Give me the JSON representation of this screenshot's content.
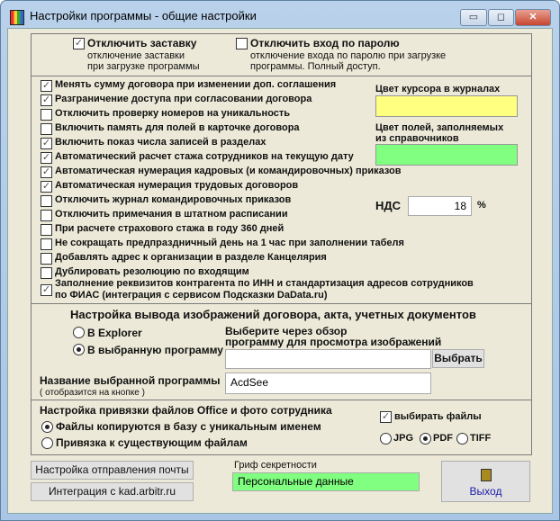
{
  "window": {
    "title": "Настройки программы - общие настройки",
    "minimize": "▭",
    "maximize": "◻",
    "close": "✕"
  },
  "top": {
    "splash": {
      "label": "Отключить заставку",
      "desc1": "отключение заставки",
      "desc2": "при загрузке программы",
      "checked": true
    },
    "password": {
      "label": "Отключить вход по паролю",
      "desc1": "отключение входа по паролю при загрузке",
      "desc2": "программы. Полный доступ.",
      "checked": false
    }
  },
  "options": [
    {
      "label": "Менять сумму договора при изменении доп. соглашения",
      "checked": true
    },
    {
      "label": "Разграничение доступа при согласовании договора",
      "checked": true
    },
    {
      "label": "Отключить проверку номеров на уникальность",
      "checked": false
    },
    {
      "label": "Включить память для полей в карточке договора",
      "checked": false
    },
    {
      "label": "Включить показ числа записей в разделах",
      "checked": true
    },
    {
      "label": "Автоматический расчет стажа сотрудников на текущую дату",
      "checked": true
    },
    {
      "label": "Автоматическая нумерация кадровых (и командировочных) приказов",
      "checked": true
    },
    {
      "label": "Автоматическая нумерация трудовых договоров",
      "checked": true
    },
    {
      "label": "Отключить журнал командировочных приказов",
      "checked": false
    },
    {
      "label": "Отключить примечания в штатном расписании",
      "checked": false
    },
    {
      "label": "При расчете страхового стажа в году 360 дней",
      "checked": false
    },
    {
      "label": "Не сокращать предпраздничный день на 1 час при заполнении табеля",
      "checked": false
    },
    {
      "label": "Добавлять адрес к организации в разделе Канцелярия",
      "checked": false
    },
    {
      "label": "Дублировать резолюцию по входящим",
      "checked": false
    }
  ],
  "dadata": {
    "line1": "Заполнение реквизитов контрагента по ИНН и стандартизация адресов сотрудников",
    "line2": "по ФИАС (интеграция с сервисом Подсказки DaData.ru)",
    "checked": true
  },
  "colors": {
    "cursor_label": "Цвет курсора в журналах",
    "cursor_color": "#ffff80",
    "fields_label1": "Цвет полей, заполняемых",
    "fields_label2": "из справочников",
    "fields_color": "#80ff80"
  },
  "vat": {
    "label": "НДС",
    "value": "18",
    "unit": "%"
  },
  "images": {
    "title": "Настройка вывода изображений договора,  акта, учетных документов",
    "explorer": "В Explorer",
    "program": "В выбранную программу",
    "selected": "program",
    "browse1": "Выберите через обзор",
    "browse2": "программу для просмотра изображений",
    "path_value": "",
    "browse_button": "Выбрать",
    "name_label": "Название выбранной программы",
    "name_hint": "( отобразится на кнопке )",
    "name_value": "AcdSee"
  },
  "files": {
    "title": "Настройка привязки файлов Office и фото сотрудника",
    "copy": "Файлы копируются в базу с уникальным именем",
    "link": "Привязка к существующим файлам",
    "selected": "copy",
    "choose_files": "выбирать файлы",
    "choose_checked": true,
    "formats": [
      "JPG",
      "PDF",
      "TIFF"
    ],
    "format_selected": "PDF"
  },
  "bottom": {
    "mail_button": "Настройка отправления почты",
    "kad_button": "Интеграция с kad.arbitr.ru",
    "secrecy_label": "Гриф секретности",
    "secrecy_value": "Персональные данные",
    "exit_button": "Выход"
  }
}
